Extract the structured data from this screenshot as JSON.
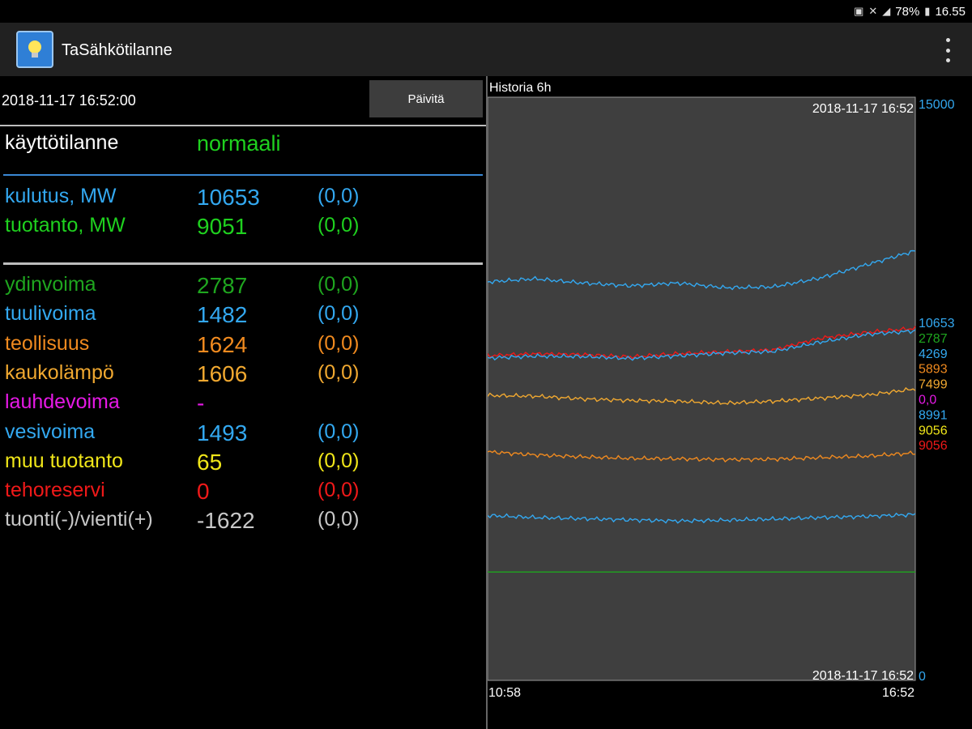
{
  "status_bar": {
    "battery": "78%",
    "time": "16.55"
  },
  "app": {
    "title": "TaSähkötilanne"
  },
  "panel": {
    "timestamp": "2018-11-17 16:52:00",
    "refresh_label": "Päivitä",
    "state": {
      "label": "käyttötilanne",
      "value": "normaali",
      "color": "#1fd11f"
    },
    "summary": [
      {
        "label": "kulutus, MW",
        "value": "10653",
        "change": "(0,0)",
        "color": "#33a8f0",
        "change_color": "#33a8f0"
      },
      {
        "label": "tuotanto, MW",
        "value": "9051",
        "change": "(0,0)",
        "color": "#1fd11f",
        "change_color": "#1fd11f"
      }
    ],
    "sources": [
      {
        "label": "ydinvoima",
        "value": "2787",
        "change": "(0,0)",
        "color": "#1fa61f"
      },
      {
        "label": "tuulivoima",
        "value": "1482",
        "change": "(0,0)",
        "color": "#33a8f0"
      },
      {
        "label": "teollisuus",
        "value": "1624",
        "change": "(0,0)",
        "color": "#f08a1f"
      },
      {
        "label": "kaukolämpö",
        "value": "1606",
        "change": "(0,0)",
        "color": "#f0a830"
      },
      {
        "label": "lauhdevoima",
        "value": "-",
        "change": "",
        "color": "#e619e6"
      },
      {
        "label": "vesivoima",
        "value": "1493",
        "change": "(0,0)",
        "color": "#33a8f0"
      },
      {
        "label": "muu tuotanto",
        "value": "65",
        "change": "(0,0)",
        "color": "#f0e619"
      },
      {
        "label": "tehoreservi",
        "value": "0",
        "change": "(0,0)",
        "color": "#f01919"
      },
      {
        "label": "tuonti(-)/vienti(+)",
        "value": "-1622",
        "change": "(0,0)",
        "color": "#c8c8c8"
      }
    ]
  },
  "chart_data": {
    "type": "line",
    "title": "Historia 6h",
    "x_start_label": "10:58",
    "x_end_label": "16:52",
    "top_timestamp": "2018-11-17 16:52",
    "bottom_timestamp": "2018-11-17 16:52",
    "ylim": [
      0,
      15000
    ],
    "y_max_label": "15000",
    "y_min_label": "0",
    "grid": false,
    "legend_values": [
      {
        "text": "10653",
        "color": "#33a8f0"
      },
      {
        "text": "2787",
        "color": "#1fa61f"
      },
      {
        "text": "4269",
        "color": "#33a8f0"
      },
      {
        "text": "5893",
        "color": "#f08a1f"
      },
      {
        "text": "7499",
        "color": "#f0a830"
      },
      {
        "text": "0,0",
        "color": "#e619e6"
      },
      {
        "text": "8991",
        "color": "#33a8f0"
      },
      {
        "text": "9056",
        "color": "#f0e619"
      },
      {
        "text": "9056",
        "color": "#f01919"
      }
    ],
    "series": [
      {
        "color": "#33a8f0",
        "values": [
          10250,
          10330,
          10220,
          10150,
          10220,
          10100,
          10120,
          10350,
          10700,
          11050
        ]
      },
      {
        "color": "#f01919",
        "values": [
          8350,
          8400,
          8380,
          8320,
          8400,
          8450,
          8500,
          8800,
          8950,
          9056
        ]
      },
      {
        "color": "#33a8f0",
        "values": [
          8290,
          8340,
          8330,
          8280,
          8350,
          8420,
          8460,
          8700,
          8900,
          8991
        ]
      },
      {
        "color": "#f0a830",
        "values": [
          7330,
          7310,
          7240,
          7200,
          7180,
          7130,
          7180,
          7260,
          7340,
          7499
        ]
      },
      {
        "color": "#f08a1f",
        "values": [
          5880,
          5800,
          5750,
          5710,
          5700,
          5680,
          5690,
          5730,
          5770,
          5850
        ]
      },
      {
        "color": "#33a8f0",
        "values": [
          4240,
          4190,
          4160,
          4130,
          4100,
          4120,
          4150,
          4190,
          4220,
          4269
        ]
      },
      {
        "color": "#1fa61f",
        "values": [
          2787,
          2787,
          2787,
          2787,
          2787,
          2787,
          2787,
          2787,
          2787,
          2787
        ]
      }
    ]
  }
}
